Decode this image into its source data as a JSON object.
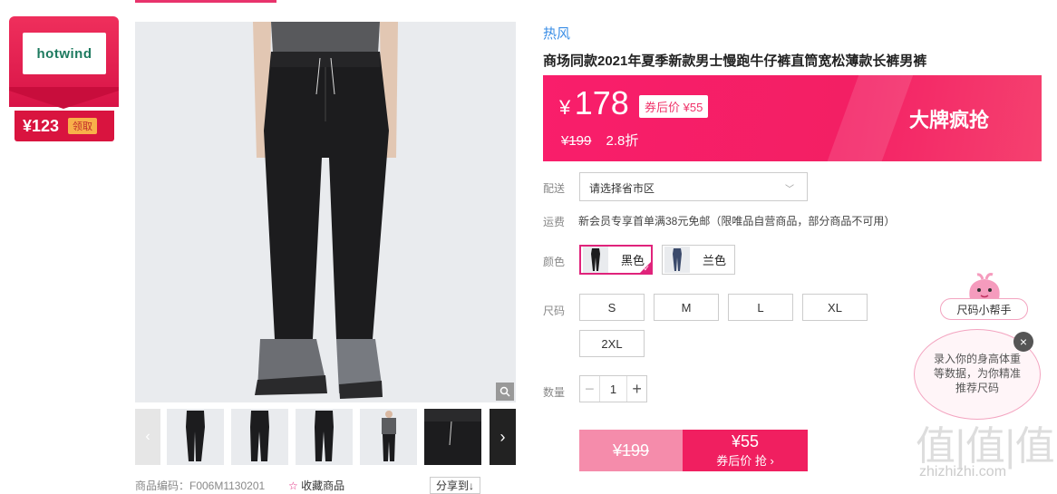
{
  "coupon": {
    "logo_text": "hotwind",
    "price": "¥123",
    "get_label": "领取"
  },
  "gallery": {
    "prev_label": "‹",
    "next_label": "›",
    "thumb_count": 6
  },
  "under_image": {
    "code_label": "商品编码：F006M1130201",
    "fav_label": "收藏商品",
    "share_label": "分享到↓"
  },
  "product": {
    "brand": "热风",
    "title": "商场同款2021年夏季新款男士慢跑牛仔裤直筒宽松薄款长裤男裤"
  },
  "price": {
    "symbol": "¥",
    "current": "178",
    "after_coupon": "券后价 ¥55",
    "original": "¥199",
    "discount": "2.8折",
    "promo": "大牌疯抢"
  },
  "delivery": {
    "label": "配送",
    "select_placeholder": "请选择省市区"
  },
  "freight": {
    "label": "运费",
    "text": "新会员专享首单满38元免邮（限唯品自营商品，部分商品不可用）"
  },
  "colors": {
    "label": "颜色",
    "options": [
      {
        "name": "黑色",
        "selected": true
      },
      {
        "name": "兰色",
        "selected": false
      }
    ]
  },
  "sizes": {
    "label": "尺码",
    "options": [
      "S",
      "M",
      "L",
      "XL",
      "2XL"
    ]
  },
  "quantity": {
    "label": "数量",
    "value": "1",
    "minus": "−",
    "plus": "+"
  },
  "buy": {
    "original": "¥199",
    "coupon_price": "¥55",
    "coupon_action": "券后价 抢 ›"
  },
  "size_helper": {
    "tag": "尺码小帮手",
    "tip": "录入你的身高体重等数据，为你精准推荐尺码",
    "close": "×"
  },
  "watermark": {
    "text": "值|值|值",
    "url": "zhizhizhi.com"
  },
  "colors_theme": {
    "accent": "#f01f60",
    "brand_link": "#3a8ee6",
    "coupon_red": "#d9143f"
  }
}
